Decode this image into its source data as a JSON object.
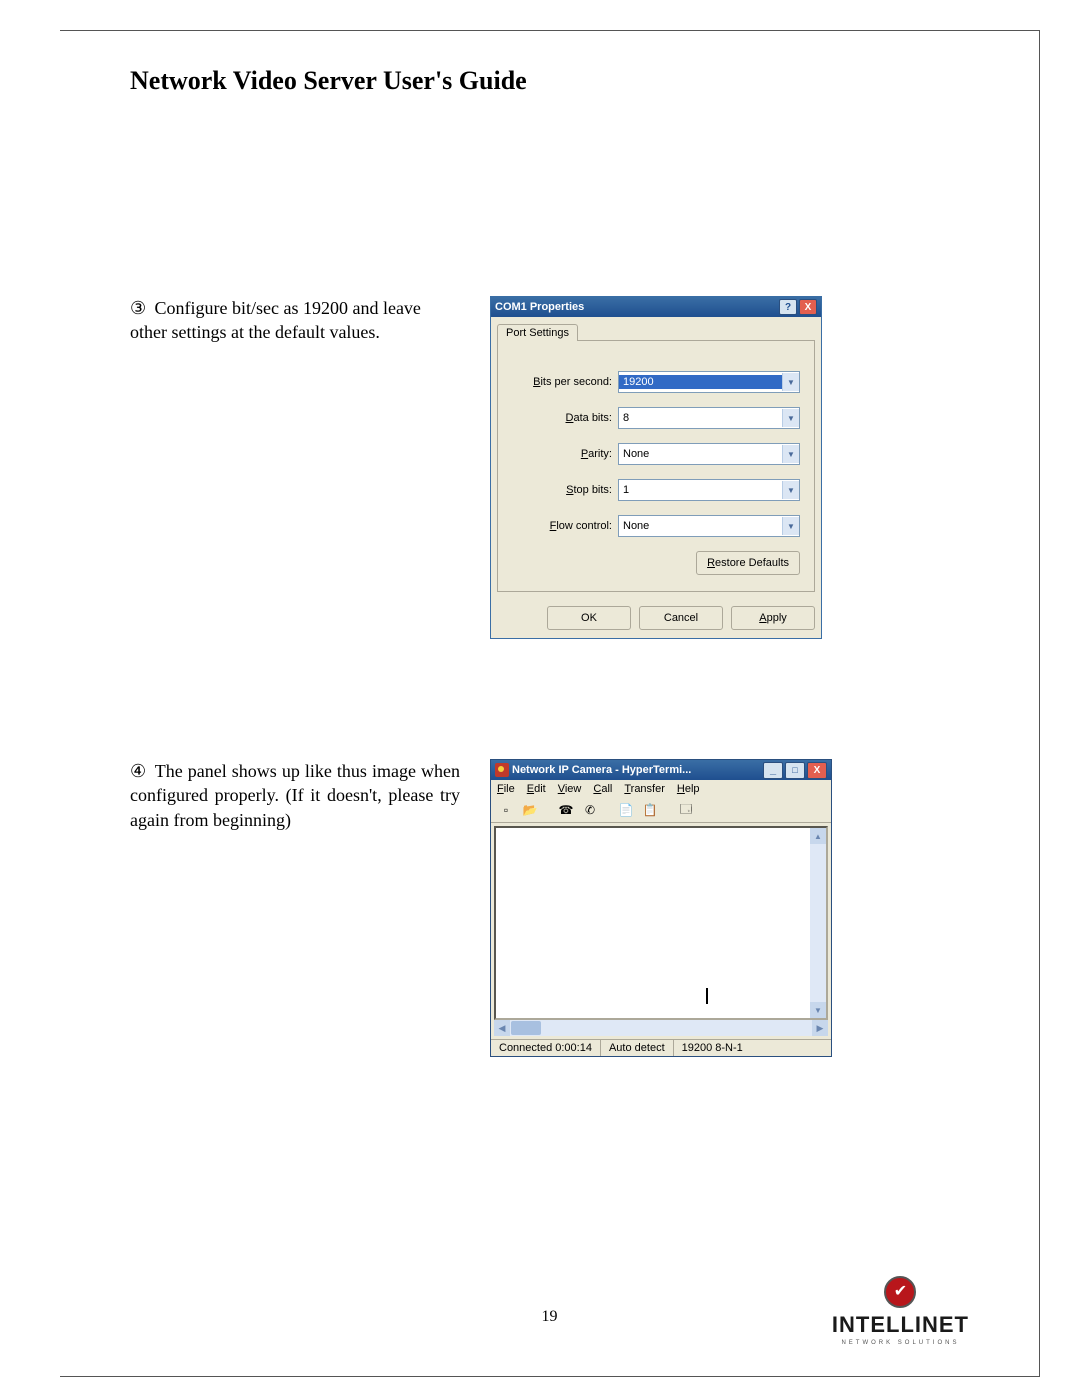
{
  "doc": {
    "title": "Network Video Server User's Guide",
    "page_number": "19"
  },
  "step3": {
    "marker": "③",
    "text": "Configure bit/sec as 19200 and leave other settings at the default values."
  },
  "step4": {
    "marker": "④",
    "text": "The panel shows up like thus image when configured properly. (If it doesn't, please try again from beginning)"
  },
  "dlg1": {
    "title": "COM1 Properties",
    "tab": "Port Settings",
    "fields": {
      "bits_per_second": {
        "label_prefix": "B",
        "label_rest": "its per second:",
        "value": "19200"
      },
      "data_bits": {
        "label_prefix": "D",
        "label_rest": "ata bits:",
        "value": "8"
      },
      "parity": {
        "label_prefix": "P",
        "label_rest": "arity:",
        "value": "None"
      },
      "stop_bits": {
        "label_prefix": "S",
        "label_rest": "top bits:",
        "value": "1"
      },
      "flow_control": {
        "label_prefix": "F",
        "label_rest": "low control:",
        "value": "None"
      }
    },
    "restore": {
      "prefix": "R",
      "rest": "estore Defaults"
    },
    "ok": "OK",
    "cancel": "Cancel",
    "apply": {
      "prefix": "A",
      "rest": "pply"
    }
  },
  "dlg2": {
    "title": "Network IP Camera - HyperTermi...",
    "menu": {
      "file": {
        "u": "F",
        "rest": "ile"
      },
      "edit": {
        "u": "E",
        "rest": "dit"
      },
      "view": {
        "u": "V",
        "rest": "iew"
      },
      "call": {
        "u": "C",
        "rest": "all"
      },
      "transfer": {
        "u": "T",
        "rest": "ransfer"
      },
      "help": {
        "u": "H",
        "rest": "elp"
      }
    },
    "status": {
      "connected": "Connected 0:00:14",
      "detect": "Auto detect",
      "mode": "19200 8-N-1"
    }
  },
  "logo": {
    "brand": "INTELLINET",
    "sub": "NETWORK SOLUTIONS"
  }
}
